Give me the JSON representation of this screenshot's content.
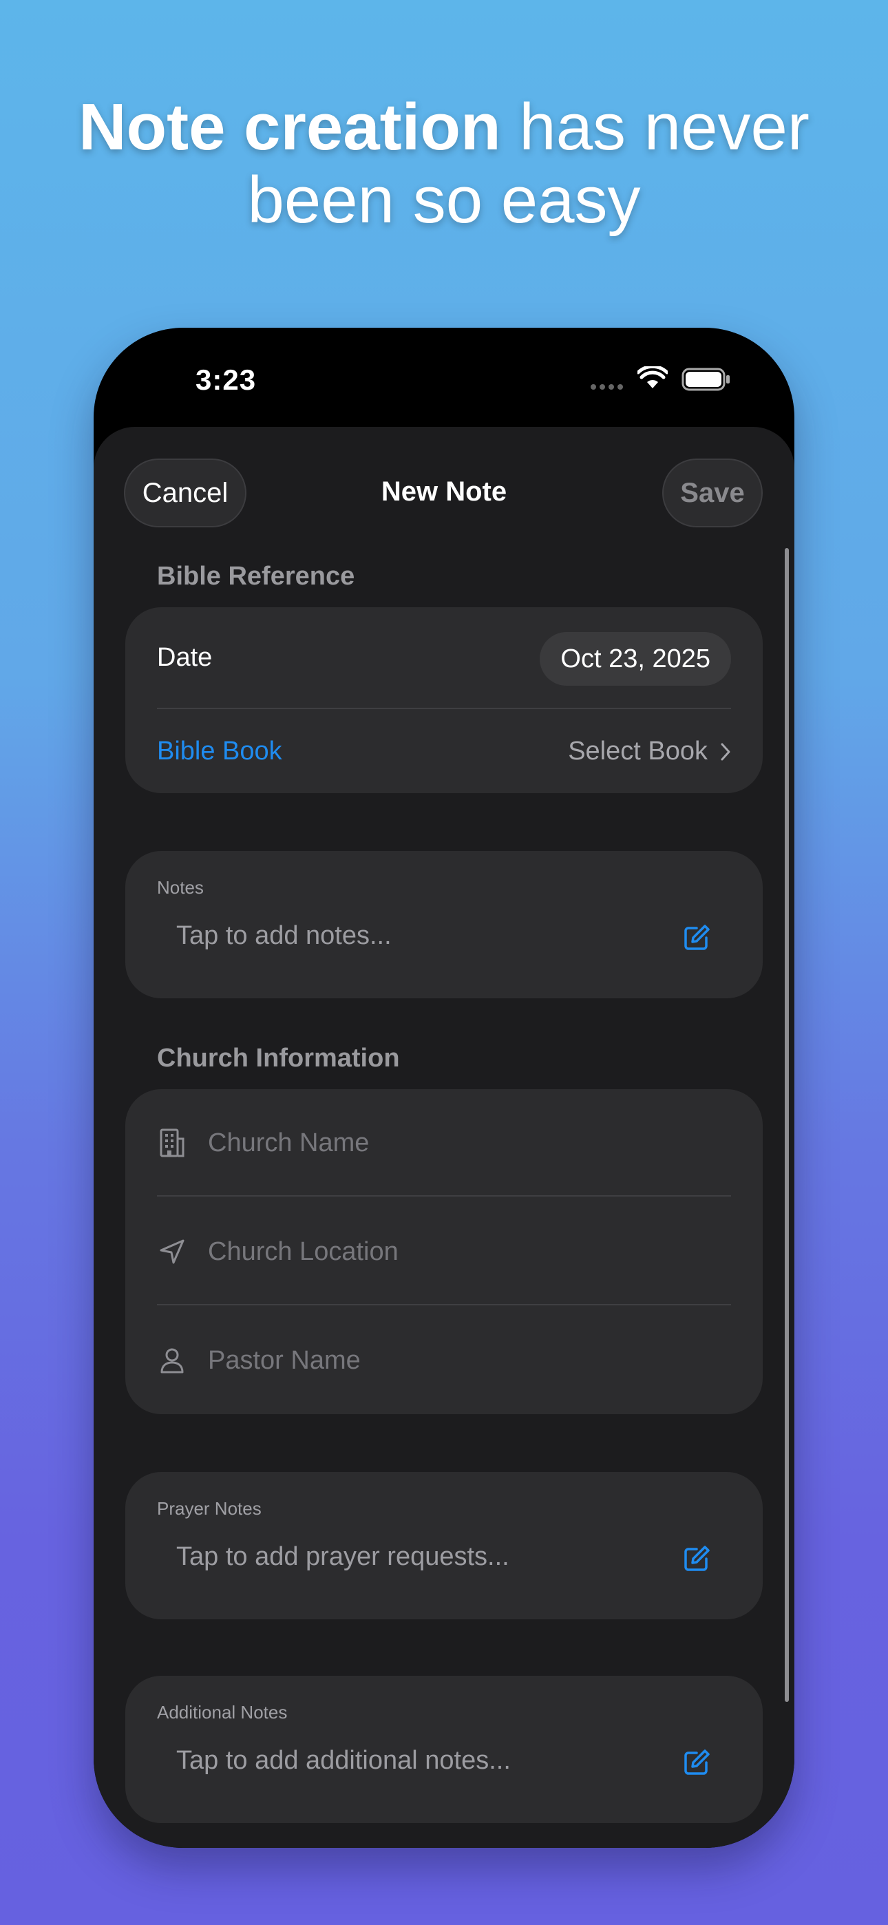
{
  "headline": {
    "bold": "Note creation",
    "rest": " has never been so easy"
  },
  "status_bar": {
    "time": "3:23"
  },
  "nav": {
    "cancel_label": "Cancel",
    "title": "New Note",
    "save_label": "Save"
  },
  "bible_reference": {
    "header": "Bible Reference",
    "date_label": "Date",
    "date_value": "Oct 23, 2025",
    "book_label": "Bible Book",
    "book_value": "Select Book"
  },
  "notes": {
    "label": "Notes",
    "placeholder": "Tap to add notes..."
  },
  "church_information": {
    "header": "Church Information",
    "church_name_placeholder": "Church Name",
    "church_location_placeholder": "Church Location",
    "pastor_name_placeholder": "Pastor Name"
  },
  "prayer_notes": {
    "label": "Prayer Notes",
    "placeholder": "Tap to add prayer requests..."
  },
  "additional_notes": {
    "label": "Additional Notes",
    "placeholder": "Tap to add additional notes..."
  },
  "colors": {
    "accent": "#1f8cf0",
    "card": "#2c2c2e",
    "sheet": "#1c1c1e"
  }
}
